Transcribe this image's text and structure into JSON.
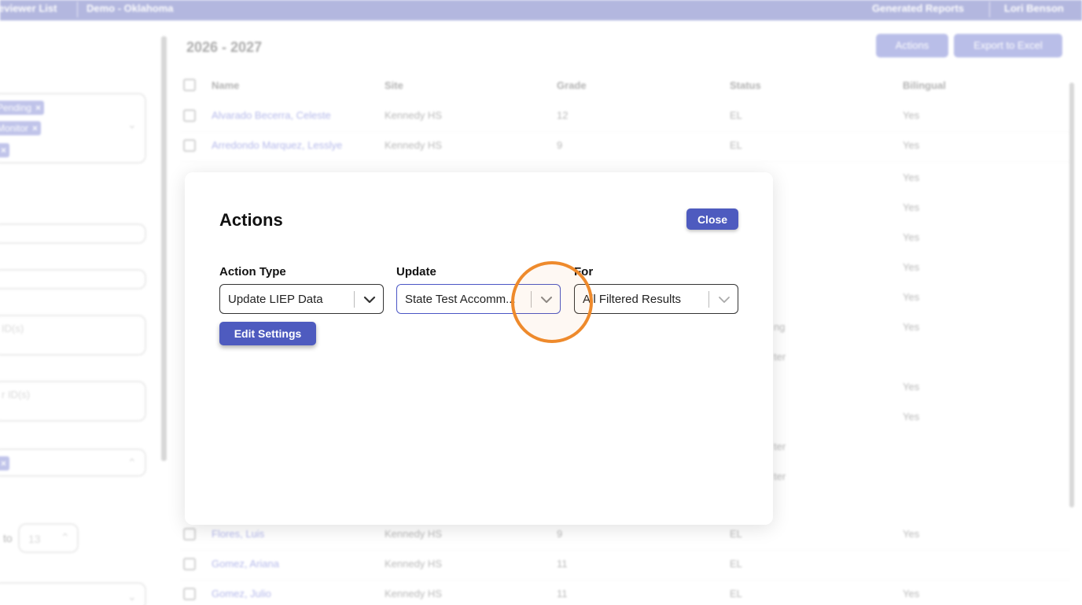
{
  "topbar": {
    "item1": "eviewer List",
    "item2": "Demo - Oklahoma",
    "item3": "Generated Reports",
    "user": "Lori Benson"
  },
  "sidebar": {
    "chips": [
      "Pending",
      "Monitor",
      ""
    ],
    "ph1": "ID(s)",
    "ph2": "r ID(s)",
    "to_label": "to",
    "to_value": "13"
  },
  "page": {
    "year": "2026 - 2027",
    "actions_button": "Actions",
    "export_button": "Export to Excel"
  },
  "table": {
    "headers": [
      "Name",
      "Site",
      "Grade",
      "Status",
      "Bilingual"
    ],
    "rows": [
      {
        "name": "Alvarado Becerra, Celeste",
        "site": "Kennedy HS",
        "grade": "12",
        "status": "EL",
        "bilingual": "Yes"
      },
      {
        "name": "Arredondo Marquez, Lesslye",
        "site": "Kennedy HS",
        "grade": "9",
        "status": "EL",
        "bilingual": "Yes"
      },
      {
        "name": "Flores, Luis",
        "site": "Kennedy HS",
        "grade": "9",
        "status": "EL",
        "bilingual": "Yes"
      },
      {
        "name": "Gomez, Ariana",
        "site": "Kennedy HS",
        "grade": "11",
        "status": "EL",
        "bilingual": ""
      },
      {
        "name": "Gomez, Julio",
        "site": "Kennedy HS",
        "grade": "11",
        "status": "EL",
        "bilingual": "Yes"
      }
    ],
    "right_fragments": [
      "Yes",
      "Yes",
      "Yes",
      "Yes",
      "Yes",
      "ng",
      "Yes",
      "ter",
      "Yes",
      "Yes",
      "ter",
      "ter"
    ]
  },
  "modal": {
    "title": "Actions",
    "close_label": "Close",
    "action_type_label": "Action Type",
    "action_type_value": "Update LIEP Data",
    "update_label": "Update",
    "update_value": "State Test Accomm...",
    "for_label": "For",
    "for_value": "All Filtered Results",
    "edit_settings_label": "Edit Settings"
  },
  "colors": {
    "primary": "#4e5bbf",
    "topbar": "#3a45ad",
    "highlight_ring": "#ee8a2c"
  }
}
